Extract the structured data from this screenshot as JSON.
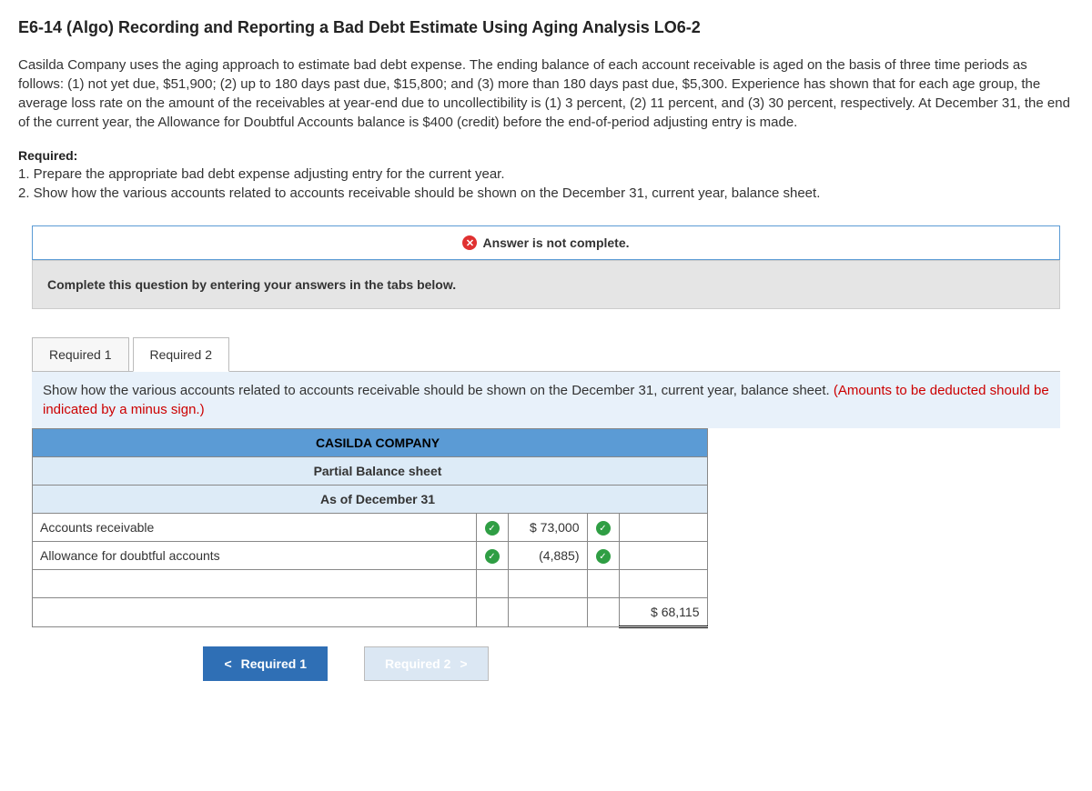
{
  "title": "E6-14 (Algo) Recording and Reporting a Bad Debt Estimate Using Aging Analysis LO6-2",
  "problem": "Casilda Company uses the aging approach to estimate bad debt expense. The ending balance of each account receivable is aged on the basis of three time periods as follows: (1) not yet due, $51,900; (2) up to 180 days past due, $15,800; and (3) more than 180 days past due, $5,300. Experience has shown that for each age group, the average loss rate on the amount of the receivables at year-end due to uncollectibility is (1) 3 percent, (2) 11 percent, and (3) 30 percent, respectively. At December 31, the end of the current year, the Allowance for Doubtful Accounts balance is $400 (credit) before the end-of-period adjusting entry is made.",
  "required": {
    "label": "Required:",
    "item1": "1. Prepare the appropriate bad debt expense adjusting entry for the current year.",
    "item2": "2. Show how the various accounts related to accounts receivable should be shown on the December 31, current year, balance sheet."
  },
  "status_banner": "Answer is not complete.",
  "instruction": "Complete this question by entering your answers in the tabs below.",
  "tabs": {
    "t1": "Required 1",
    "t2": "Required 2"
  },
  "tab_content": {
    "main": "Show how the various accounts related to accounts receivable should be shown on the December 31, current year, balance sheet. ",
    "hint": "(Amounts to be deducted should be indicated by a minus sign.)"
  },
  "balance_sheet": {
    "company": "CASILDA COMPANY",
    "title": "Partial Balance sheet",
    "asof": "As of December 31",
    "rows": {
      "r1_label": "Accounts receivable",
      "r1_value": "$   73,000",
      "r2_label": "Allowance for doubtful accounts",
      "r2_value": "(4,885)",
      "total": "$   68,115"
    }
  },
  "nav": {
    "prev": "Required 1",
    "next": "Required 2"
  }
}
